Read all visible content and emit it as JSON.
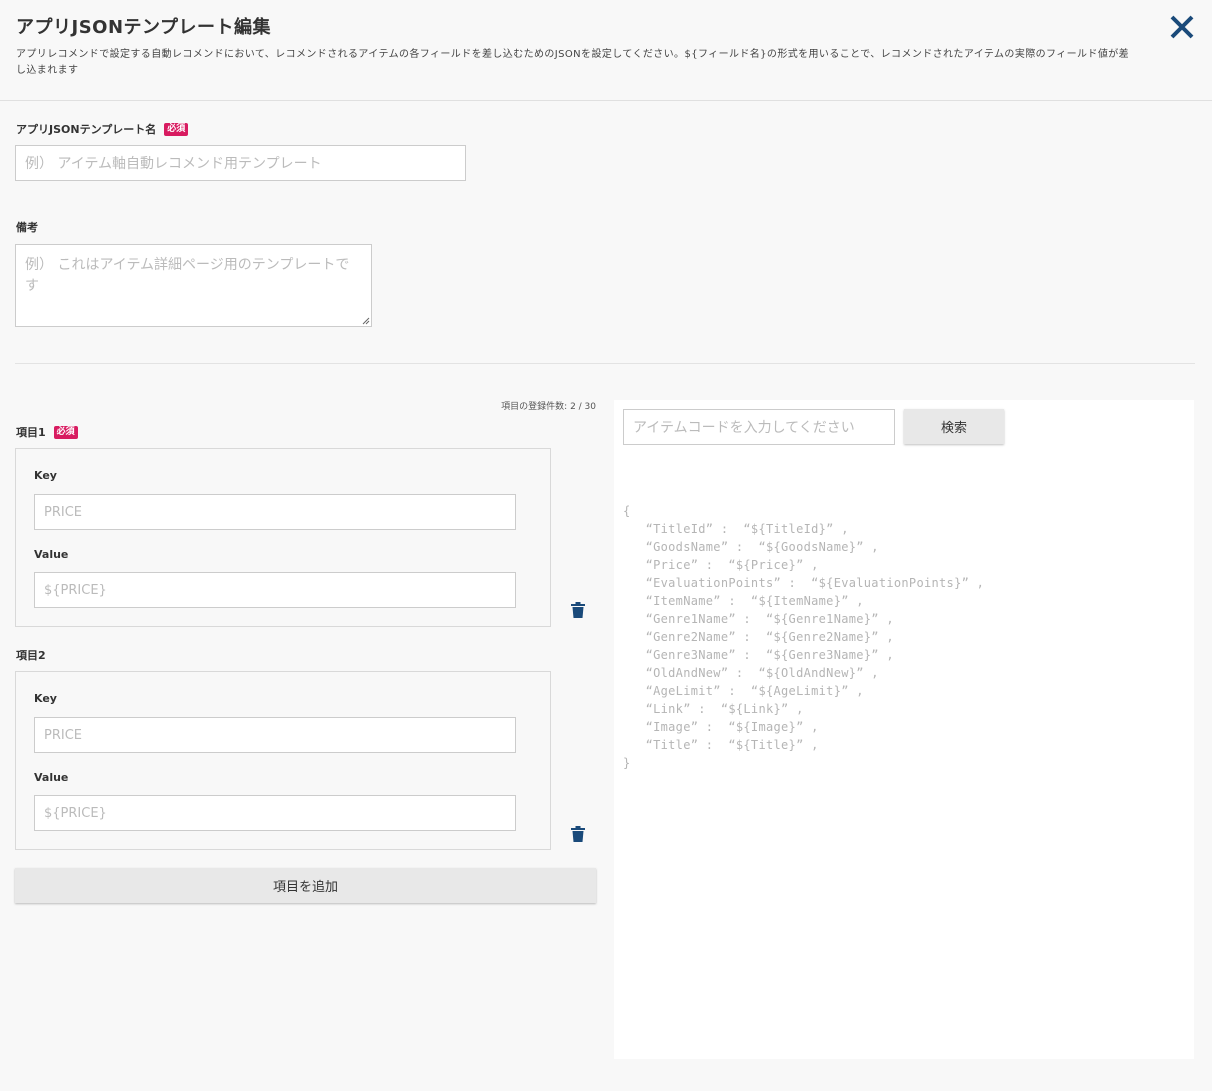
{
  "header": {
    "title": "アプリJSONテンプレート編集",
    "description": "アプリレコメンドで設定する自動レコメンドにおいて、レコメンドされるアイテムの各フィールドを差し込むためのJSONを設定してください。${フィールド名}の形式を用いることで、レコメンドされたアイテムの実際のフィールド値が差し込まれます",
    "close_icon": "close-icon"
  },
  "template_name": {
    "label": "アプリJSONテンプレート名",
    "required_badge": "必須",
    "placeholder": "例） アイテム軸自動レコメンド用テンプレート"
  },
  "notes": {
    "label": "備考",
    "placeholder": "例） これはアイテム詳細ページ用のテンプレートです"
  },
  "items_section": {
    "count_text": "項目の登録件数: 2 / 30",
    "add_button_label": "項目を追加",
    "items": [
      {
        "label": "項目1",
        "required_badge": "必須",
        "key_label": "Key",
        "key_placeholder": "PRICE",
        "value_label": "Value",
        "value_placeholder": "${PRICE}"
      },
      {
        "label": "項目2",
        "key_label": "Key",
        "key_placeholder": "PRICE",
        "value_label": "Value",
        "value_placeholder": "${PRICE}"
      }
    ]
  },
  "preview": {
    "search_placeholder": "アイテムコードを入力してください",
    "search_button_label": "検索",
    "json_lines": [
      "{",
      "   “TitleId” :  “${TitleId}” ,",
      "   “GoodsName” :  “${GoodsName}” ,",
      "   “Price” :  “${Price}” ,",
      "   “EvaluationPoints” :  “${EvaluationPoints}” ,",
      "   “ItemName” :  “${ItemName}” ,",
      "   “Genre1Name” :  “${Genre1Name}” ,",
      "   “Genre2Name” :  “${Genre2Name}” ,",
      "   “Genre3Name” :  “${Genre3Name}” ,",
      "   “OldAndNew” :  “${OldAndNew}” ,",
      "   “AgeLimit” :  “${AgeLimit}” ,",
      "   “Link” :  “${Link}” ,",
      "   “Image” :  “${Image}” ,",
      "   “Title” :  “${Title}” ,",
      "}"
    ]
  },
  "colors": {
    "accent": "#1a4a7a",
    "badge": "#d81b60",
    "background": "#f8f8f8"
  }
}
